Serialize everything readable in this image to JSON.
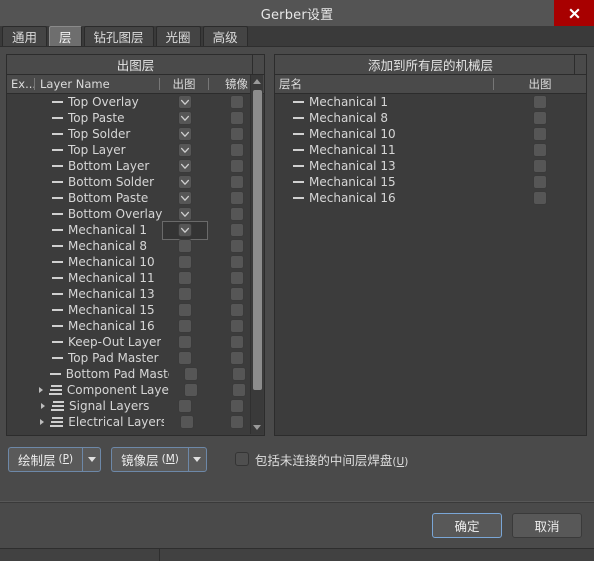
{
  "window": {
    "title": "Gerber设置",
    "close_icon": "close-icon"
  },
  "tabs": [
    {
      "label": "通用",
      "active": false
    },
    {
      "label": "层",
      "active": true
    },
    {
      "label": "钻孔图层",
      "active": false
    },
    {
      "label": "光圈",
      "active": false
    },
    {
      "label": "高级",
      "active": false
    }
  ],
  "left_panel": {
    "title": "出图层",
    "columns": {
      "ex": "Ex...",
      "name": "Layer Name",
      "plot": "出图",
      "mirror": "镜像"
    },
    "rows": [
      {
        "name": "Top Overlay",
        "type": "layer",
        "plot": true,
        "mirror": false,
        "focused": false
      },
      {
        "name": "Top Paste",
        "type": "layer",
        "plot": true,
        "mirror": false,
        "focused": false
      },
      {
        "name": "Top Solder",
        "type": "layer",
        "plot": true,
        "mirror": false,
        "focused": false
      },
      {
        "name": "Top Layer",
        "type": "layer",
        "plot": true,
        "mirror": false,
        "focused": false
      },
      {
        "name": "Bottom Layer",
        "type": "layer",
        "plot": true,
        "mirror": false,
        "focused": false
      },
      {
        "name": "Bottom Solder",
        "type": "layer",
        "plot": true,
        "mirror": false,
        "focused": false
      },
      {
        "name": "Bottom Paste",
        "type": "layer",
        "plot": true,
        "mirror": false,
        "focused": false
      },
      {
        "name": "Bottom Overlay",
        "type": "layer",
        "plot": true,
        "mirror": false,
        "focused": false
      },
      {
        "name": "Mechanical 1",
        "type": "layer",
        "plot": true,
        "mirror": false,
        "focused": true
      },
      {
        "name": "Mechanical 8",
        "type": "layer",
        "plot": false,
        "mirror": false,
        "focused": false
      },
      {
        "name": "Mechanical 10",
        "type": "layer",
        "plot": false,
        "mirror": false,
        "focused": false
      },
      {
        "name": "Mechanical 11",
        "type": "layer",
        "plot": false,
        "mirror": false,
        "focused": false
      },
      {
        "name": "Mechanical 13",
        "type": "layer",
        "plot": false,
        "mirror": false,
        "focused": false
      },
      {
        "name": "Mechanical 15",
        "type": "layer",
        "plot": false,
        "mirror": false,
        "focused": false
      },
      {
        "name": "Mechanical 16",
        "type": "layer",
        "plot": false,
        "mirror": false,
        "focused": false
      },
      {
        "name": "Keep-Out Layer",
        "type": "layer",
        "plot": false,
        "mirror": false,
        "focused": false
      },
      {
        "name": "Top Pad Master",
        "type": "layer",
        "plot": false,
        "mirror": false,
        "focused": false
      },
      {
        "name": "Bottom Pad Master",
        "type": "layer",
        "plot": false,
        "mirror": false,
        "focused": false
      },
      {
        "name": "Component Layers",
        "type": "group",
        "plot": false,
        "mirror": false,
        "focused": false
      },
      {
        "name": "Signal Layers",
        "type": "group",
        "plot": false,
        "mirror": false,
        "focused": false
      },
      {
        "name": "Electrical Layers",
        "type": "group",
        "plot": false,
        "mirror": false,
        "focused": false
      }
    ]
  },
  "right_panel": {
    "title": "添加到所有层的机械层",
    "columns": {
      "name": "层名",
      "plot": "出图"
    },
    "rows": [
      {
        "name": "Mechanical 1",
        "plot": false
      },
      {
        "name": "Mechanical 8",
        "plot": false
      },
      {
        "name": "Mechanical 10",
        "plot": false
      },
      {
        "name": "Mechanical 11",
        "plot": false
      },
      {
        "name": "Mechanical 13",
        "plot": false
      },
      {
        "name": "Mechanical 15",
        "plot": false
      },
      {
        "name": "Mechanical 16",
        "plot": false
      }
    ]
  },
  "options": {
    "plot_layers_label": "绘制层",
    "plot_layers_accel": "P",
    "mirror_layers_label": "镜像层",
    "mirror_layers_accel": "M",
    "include_pads_label": "包括未连接的中间层焊盘",
    "include_pads_accel": "U",
    "include_pads_checked": false
  },
  "footer": {
    "ok_label": "确定",
    "cancel_label": "取消"
  },
  "colors": {
    "dialog_bg": "#4a4a4a",
    "panel_bg": "#3c3c3c",
    "titlebar_bg": "#545454",
    "close_red": "#a80000",
    "accent_blue": "#7aa6d6",
    "text": "#dcdcdc"
  }
}
